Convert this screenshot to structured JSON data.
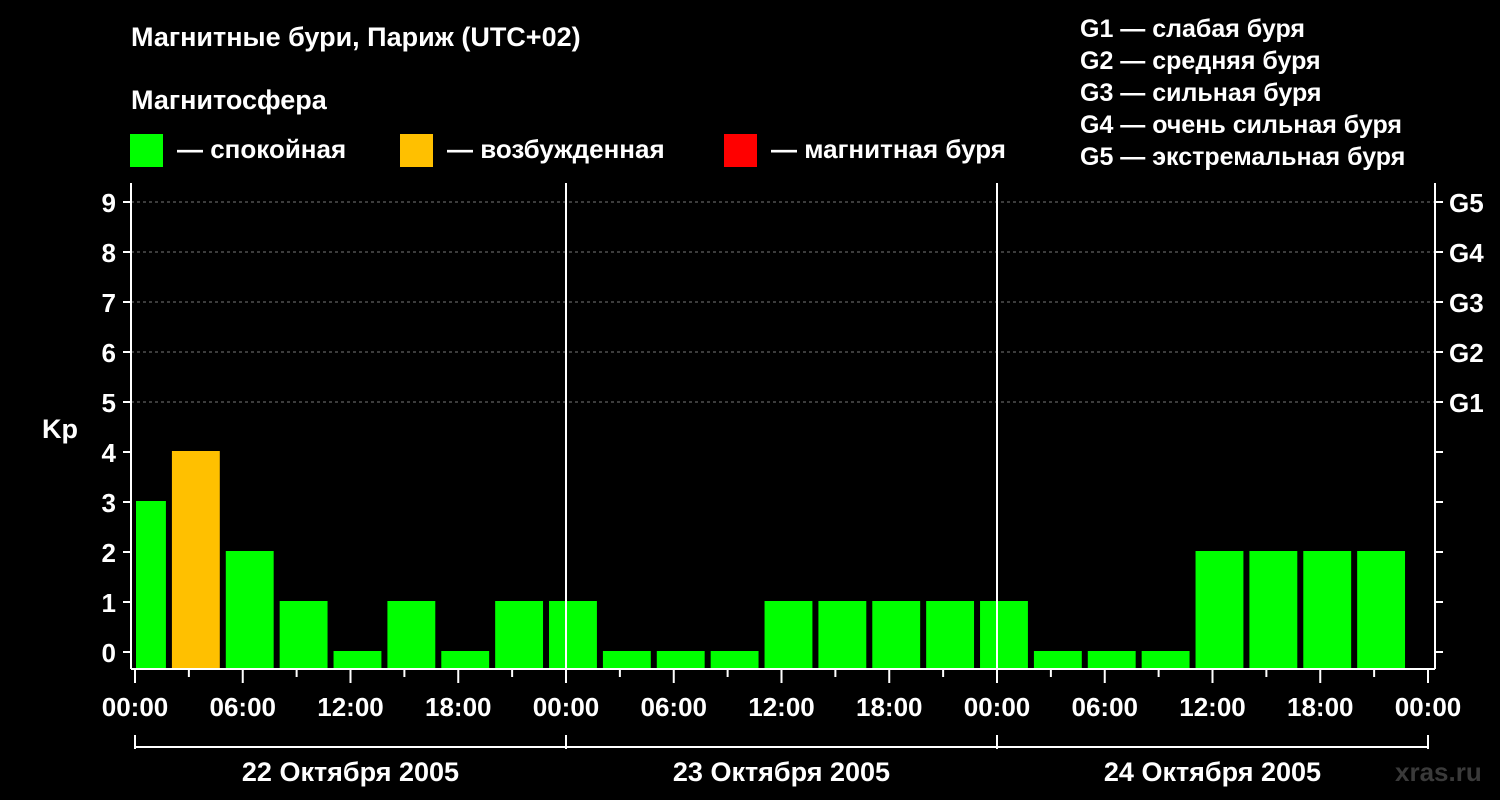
{
  "title": "Магнитные бури, Париж (UTC+02)",
  "legend": {
    "heading": "Магнитосфера",
    "items": [
      {
        "label": "— спокойная",
        "color": "#00ff00"
      },
      {
        "label": "— возбужденная",
        "color": "#ffc000"
      },
      {
        "label": "— магнитная буря",
        "color": "#ff0000"
      }
    ]
  },
  "g_scale": [
    "G1 — слабая буря",
    "G2 — средняя буря",
    "G3 — сильная буря",
    "G4 — очень сильная буря",
    "G5 — экстремальная буря"
  ],
  "watermark": "xras.ru",
  "chart_data": {
    "type": "bar",
    "ylabel": "Kp",
    "ylim": [
      0,
      9
    ],
    "yticks": [
      "0",
      "1",
      "2",
      "3",
      "4",
      "5",
      "6",
      "7",
      "8",
      "9"
    ],
    "right_axis_labels": [
      {
        "kp": 5,
        "label": "G1"
      },
      {
        "kp": 6,
        "label": "G2"
      },
      {
        "kp": 7,
        "label": "G3"
      },
      {
        "kp": 8,
        "label": "G4"
      },
      {
        "kp": 9,
        "label": "G5"
      }
    ],
    "x_tick_labels": [
      "00:00",
      "06:00",
      "12:00",
      "18:00",
      "00:00",
      "06:00",
      "12:00",
      "18:00",
      "00:00",
      "06:00",
      "12:00",
      "18:00",
      "00:00"
    ],
    "days": [
      "22 Октября 2005",
      "23 Октября 2005",
      "24 Октября 2005"
    ],
    "interval_hours": 3,
    "bars": [
      {
        "start_hour": 0,
        "end_hour": 2,
        "kp": 3,
        "level": "quiet"
      },
      {
        "start_hour": 2,
        "end_hour": 5,
        "kp": 4,
        "level": "active"
      },
      {
        "start_hour": 5,
        "end_hour": 8,
        "kp": 2,
        "level": "quiet"
      },
      {
        "start_hour": 8,
        "end_hour": 11,
        "kp": 1,
        "level": "quiet"
      },
      {
        "start_hour": 11,
        "end_hour": 14,
        "kp": 0,
        "level": "quiet"
      },
      {
        "start_hour": 14,
        "end_hour": 17,
        "kp": 1,
        "level": "quiet"
      },
      {
        "start_hour": 17,
        "end_hour": 20,
        "kp": 0,
        "level": "quiet"
      },
      {
        "start_hour": 20,
        "end_hour": 23,
        "kp": 1,
        "level": "quiet"
      },
      {
        "start_hour": 23,
        "end_hour": 26,
        "kp": 1,
        "level": "quiet"
      },
      {
        "start_hour": 26,
        "end_hour": 29,
        "kp": 0,
        "level": "quiet"
      },
      {
        "start_hour": 29,
        "end_hour": 32,
        "kp": 0,
        "level": "quiet"
      },
      {
        "start_hour": 32,
        "end_hour": 35,
        "kp": 0,
        "level": "quiet"
      },
      {
        "start_hour": 35,
        "end_hour": 38,
        "kp": 1,
        "level": "quiet"
      },
      {
        "start_hour": 38,
        "end_hour": 41,
        "kp": 1,
        "level": "quiet"
      },
      {
        "start_hour": 41,
        "end_hour": 44,
        "kp": 1,
        "level": "quiet"
      },
      {
        "start_hour": 44,
        "end_hour": 47,
        "kp": 1,
        "level": "quiet"
      },
      {
        "start_hour": 47,
        "end_hour": 50,
        "kp": 1,
        "level": "quiet"
      },
      {
        "start_hour": 50,
        "end_hour": 53,
        "kp": 0,
        "level": "quiet"
      },
      {
        "start_hour": 53,
        "end_hour": 56,
        "kp": 0,
        "level": "quiet"
      },
      {
        "start_hour": 56,
        "end_hour": 59,
        "kp": 0,
        "level": "quiet"
      },
      {
        "start_hour": 59,
        "end_hour": 62,
        "kp": 2,
        "level": "quiet"
      },
      {
        "start_hour": 62,
        "end_hour": 65,
        "kp": 2,
        "level": "quiet"
      },
      {
        "start_hour": 65,
        "end_hour": 68,
        "kp": 2,
        "level": "quiet"
      },
      {
        "start_hour": 68,
        "end_hour": 71,
        "kp": 2,
        "level": "quiet"
      }
    ],
    "grid": true
  }
}
